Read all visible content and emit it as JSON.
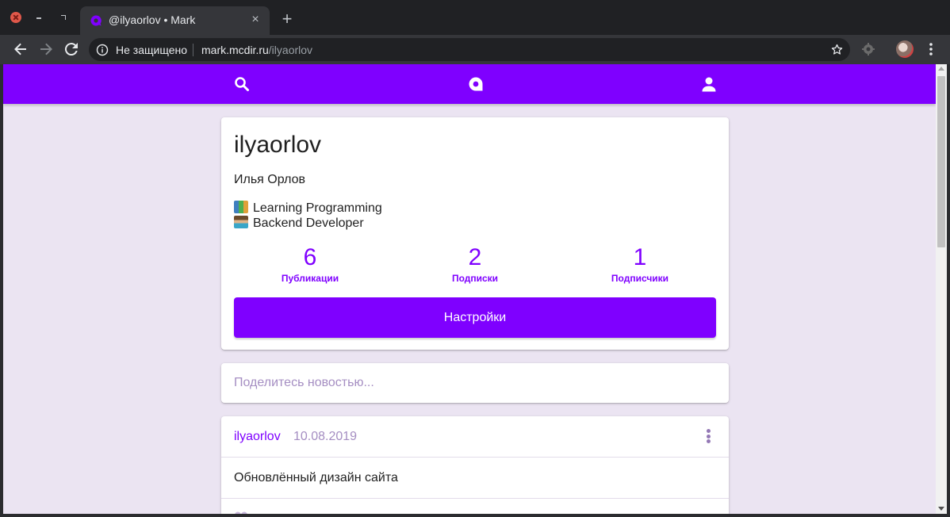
{
  "browser": {
    "tab": {
      "title": "@ilyaorlov • Mark",
      "close_glyph": "×",
      "favicon": "mark-logo-icon"
    },
    "new_tab_glyph": "+",
    "window_controls": [
      "close-window",
      "minimize-window",
      "maximize-window"
    ],
    "omnibox": {
      "security_label": "Не защищено",
      "url_host": "mark.mcdir.ru",
      "url_path": "/ilyaorlov"
    },
    "icons": [
      "back-arrow-icon",
      "forward-arrow-icon",
      "reload-icon",
      "info-icon",
      "bookmark-star-icon",
      "extension-icon",
      "profile-avatar",
      "menu-dots-icon"
    ]
  },
  "app": {
    "brand_color": "#7f00ff",
    "background_color": "#ebe4f2",
    "nav": [
      "search-icon",
      "home-logo-icon",
      "profile-icon"
    ]
  },
  "profile": {
    "username": "ilyaorlov",
    "full_name": "Илья Орлов",
    "bio": [
      {
        "emoji": "books-emoji",
        "text": "Learning Programming"
      },
      {
        "emoji": "technologist-emoji",
        "text": "Backend Developer"
      }
    ],
    "stats": [
      {
        "count": "6",
        "label": "Публикации"
      },
      {
        "count": "2",
        "label": "Подписки"
      },
      {
        "count": "1",
        "label": "Подписчики"
      }
    ],
    "settings_label": "Настройки"
  },
  "compose": {
    "placeholder": "Поделитесь новостью..."
  },
  "posts": [
    {
      "author": "ilyaorlov",
      "date": "10.08.2019",
      "text": "Обновлённый дизайн сайта"
    }
  ]
}
